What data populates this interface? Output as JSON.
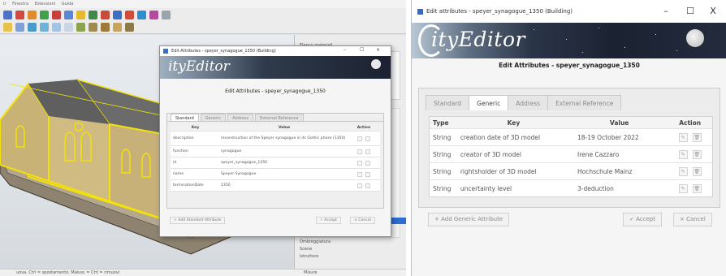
{
  "left": {
    "menubar": [
      "Ir",
      "Finestra",
      "Estensioni",
      "Guida"
    ],
    "statusbar": "uova. Ctrl = spostamento. Maiusc = Ctrl = rimuovi",
    "status_right": "Misure",
    "trays": {
      "title": "Elenco materiali",
      "items": [
        "Ombreggiatura",
        "Scene",
        "Istruttore"
      ]
    },
    "dialog": {
      "title": "Edit Attributes - speyer_synagogue_1350 (Building)",
      "logo": "ityEditor",
      "header": "Edit Attributes - speyer_synagogue_1350",
      "tabs": [
        "Standard",
        "Generic",
        "Address",
        "External Reference"
      ],
      "columns": {
        "key": "Key",
        "value": "Value",
        "action": "Action"
      },
      "rows": [
        {
          "key": "description",
          "value": "reconstruction of the Speyer synagogue in its Gothic phase (1350)"
        },
        {
          "key": "function",
          "value": "synagogue"
        },
        {
          "key": "id",
          "value": "speyer_synagogue_1350"
        },
        {
          "key": "name",
          "value": "Speyer Synagogue"
        },
        {
          "key": "terminationDate",
          "value": "1350"
        }
      ],
      "add_label": "+ Add Standard Attribute",
      "accept_label": "✓ Accept",
      "cancel_label": "× Cancel"
    }
  },
  "right": {
    "window_title": "Edit attributes - speyer_synagogue_1350 (Building)",
    "logo": "ityEditor",
    "window_controls": {
      "minimize": "–",
      "maximize": "☐",
      "close": "X"
    },
    "header": "Edit Attributes - speyer_synagogue_1350",
    "tabs": [
      "Standard",
      "Generic",
      "Address",
      "External Reference"
    ],
    "active_tab": "Generic",
    "columns": {
      "type": "Type",
      "key": "Key",
      "value": "Value",
      "action": "Action"
    },
    "rows": [
      {
        "type": "String",
        "key": "creation date of 3D model",
        "value": "18-19 October 2022"
      },
      {
        "type": "String",
        "key": "creator of 3D model",
        "value": "Irene Cazzaro"
      },
      {
        "type": "String",
        "key": "rightsholder of 3D model",
        "value": "Hochschule Mainz"
      },
      {
        "type": "String",
        "key": "uncertainty level",
        "value": "3-deduction"
      }
    ],
    "add_label": "+ Add Generic Attribute",
    "accept_label": "✓ Accept",
    "cancel_label": "× Cancel"
  },
  "colors": {
    "accent": "#3767c0",
    "selection_yellow": "#f2e10a",
    "wall": "#cdb87e",
    "roof": "#6b6b6b"
  }
}
